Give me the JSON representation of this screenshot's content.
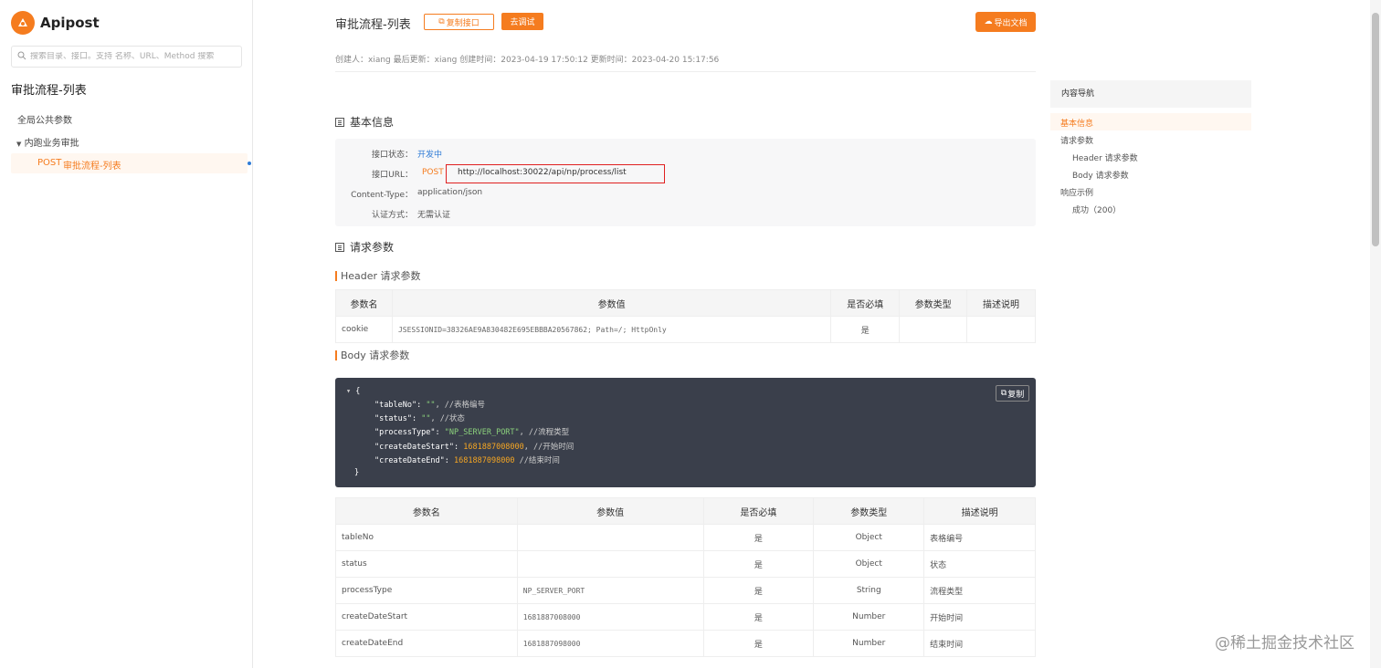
{
  "brand": {
    "name": "Apipost",
    "color": "#f57c1f"
  },
  "sidebar": {
    "search_placeholder": "搜索目录、接口。支持 名称、URL、Method 搜索",
    "title": "审批流程-列表",
    "items": [
      {
        "label": "全局公共参数"
      },
      {
        "label": "内跑业务审批",
        "expanded": true
      },
      {
        "method": "POST",
        "label": "审批流程-列表",
        "active": true
      }
    ]
  },
  "header": {
    "title": "审批流程-列表",
    "copy_label": "复制接口",
    "debug_label": "去调试",
    "export_label": "导出文档",
    "meta": "创建人：xiang  最后更新：xiang  创建时间：2023-04-19 17:50:12   更新时间：2023-04-20 15:17:56"
  },
  "basic": {
    "heading": "基本信息",
    "rows": [
      {
        "label": "接口状态：",
        "value": "开发中"
      },
      {
        "label": "接口URL：",
        "method": "POST",
        "value": "http://localhost:30022/api/np/process/list"
      },
      {
        "label": "Content-Type：",
        "value": "application/json"
      },
      {
        "label": "认证方式：",
        "value": "无需认证"
      }
    ]
  },
  "request": {
    "heading": "请求参数",
    "header_sub": "Header 请求参数",
    "header_table": {
      "columns": [
        "参数名",
        "参数值",
        "是否必填",
        "参数类型",
        "描述说明"
      ],
      "rows": [
        [
          "cookie",
          "JSESSIONID=38326AE9A830482E695EBBBA20567862; Path=/; HttpOnly",
          "是",
          "",
          ""
        ]
      ]
    },
    "body_sub": "Body 请求参数",
    "code_copy": "复制",
    "code": {
      "open": "{",
      "close": "}",
      "lines": [
        {
          "key": "\"tableNo\"",
          "value": "\"\"",
          "vtype": "s",
          "comment": ", //表格编号"
        },
        {
          "key": "\"status\"",
          "value": "\"\"",
          "vtype": "s",
          "comment": ", //状态"
        },
        {
          "key": "\"processType\"",
          "value": "\"NP_SERVER_PORT\"",
          "vtype": "s",
          "comment": ", //流程类型"
        },
        {
          "key": "\"createDateStart\"",
          "value": "1681887008000",
          "vtype": "n",
          "comment": ", //开始时间"
        },
        {
          "key": "\"createDateEnd\"",
          "value": "1681887098000",
          "vtype": "n",
          "comment": " //结束时间"
        }
      ]
    },
    "body_table": {
      "columns": [
        "参数名",
        "参数值",
        "是否必填",
        "参数类型",
        "描述说明"
      ],
      "rows": [
        [
          "tableNo",
          "",
          "是",
          "Object",
          "表格编号"
        ],
        [
          "status",
          "",
          "是",
          "Object",
          "状态"
        ],
        [
          "processType",
          "NP_SERVER_PORT",
          "是",
          "String",
          "流程类型"
        ],
        [
          "createDateStart",
          "1681887008000",
          "是",
          "Number",
          "开始时间"
        ],
        [
          "createDateEnd",
          "1681887098000",
          "是",
          "Number",
          "结束时间"
        ]
      ]
    }
  },
  "toc": {
    "heading": "内容导航",
    "items": [
      {
        "label": "基本信息",
        "active": true
      },
      {
        "label": "请求参数"
      },
      {
        "label": "Header 请求参数"
      },
      {
        "label": "Body 请求参数"
      },
      {
        "label": "响应示例"
      },
      {
        "label": "成功（200）"
      }
    ]
  },
  "watermark": "@稀土掘金技术社区"
}
